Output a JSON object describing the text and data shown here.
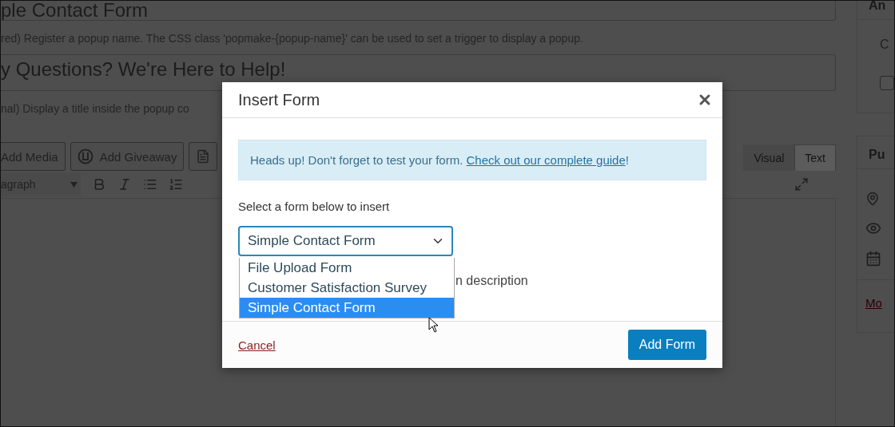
{
  "editor": {
    "title_value": "ple Contact Form",
    "title_help": "red) Register a popup name. The CSS class 'popmake-{popup-name}' can be used to set a trigger to display a popup.",
    "popup_title_value": "y Questions? We're Here to Help!",
    "popup_title_help": "nal) Display a title inside the popup co",
    "media_buttons": [
      {
        "kind": "labeled",
        "label": "Add Media"
      },
      {
        "kind": "giveaway",
        "label": "Add Giveaway"
      },
      {
        "kind": "icon-only"
      }
    ],
    "modes": [
      {
        "label": "Visual",
        "selected": false
      },
      {
        "label": "Text",
        "selected": true
      }
    ],
    "format_select": "agraph"
  },
  "sidebar": {
    "panels": [
      {
        "title": "An",
        "lines": [
          "C"
        ],
        "checkbox": {
          "checked": false
        }
      },
      {
        "title": "Pu",
        "link": "Mo"
      }
    ]
  },
  "modal": {
    "title": "Insert Form",
    "notice": {
      "text": "Heads up! Don't forget to test your form. ",
      "link": "Check out our complete guide",
      "suffix": "!"
    },
    "select_label": "Select a form below to insert",
    "select_value": "Simple Contact Form",
    "options": [
      {
        "label": "File Upload Form",
        "selected": false
      },
      {
        "label": "Customer Satisfaction Survey",
        "selected": false
      },
      {
        "label": "Simple Contact Form",
        "selected": true
      }
    ],
    "description_label": "n description",
    "cancel": "Cancel",
    "submit": "Add Form"
  }
}
